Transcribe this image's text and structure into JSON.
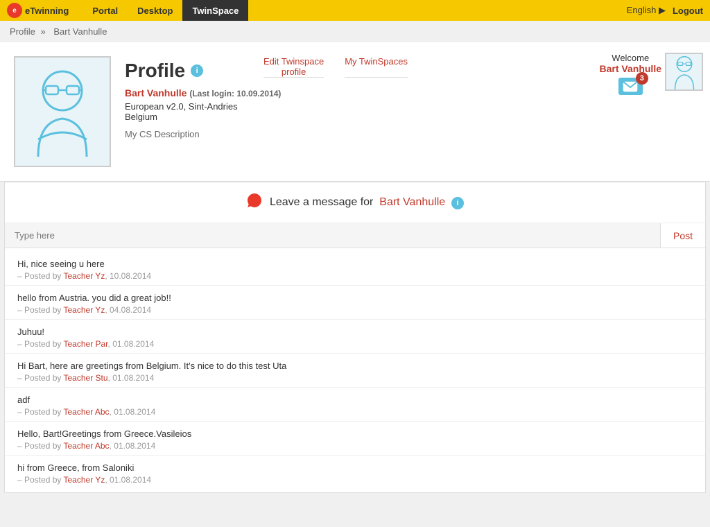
{
  "nav": {
    "logo_text": "eTwinning",
    "items": [
      "Portal",
      "Desktop",
      "TwinSpace"
    ],
    "active": "TwinSpace",
    "language": "English",
    "logout": "Logout"
  },
  "breadcrumb": {
    "profile": "Profile",
    "separator": "»",
    "current": "Bart Vanhulle"
  },
  "profile": {
    "title": "Profile",
    "info_icon": "i",
    "user_name": "Bart Vanhulle",
    "last_login_label": "(Last login: 10.09.2014)",
    "location": "European v2.0, Sint-Andries",
    "country": "Belgium",
    "description": "My CS Description",
    "edit_link_line1": "Edit Twinspace",
    "edit_link_line2": "profile",
    "my_twinspaces": "My TwinSpaces",
    "welcome_text": "Welcome",
    "welcome_name": "Bart Vanhulle",
    "mail_count": "3"
  },
  "message_section": {
    "title_prefix": "Leave a message for",
    "target_name": "Bart Vanhulle",
    "input_placeholder": "Type here",
    "post_button": "Post",
    "messages": [
      {
        "text": "Hi, nice seeing u here",
        "posted_by": "Teacher Yz",
        "date": "10.08.2014"
      },
      {
        "text": "hello from Austria. you did a great job!!",
        "posted_by": "Teacher Yz",
        "date": "04.08.2014"
      },
      {
        "text": "Juhuu!",
        "posted_by": "Teacher Par",
        "date": "01.08.2014"
      },
      {
        "text": "Hi Bart, here are greetings from Belgium. It's nice to do this test Uta",
        "posted_by": "Teacher Stu",
        "date": "01.08.2014"
      },
      {
        "text": "adf",
        "posted_by": "Teacher Abc",
        "date": "01.08.2014"
      },
      {
        "text": "Hello, Bart!Greetings from Greece.Vasileios",
        "posted_by": "Teacher Abc",
        "date": "01.08.2014"
      },
      {
        "text": "hi from Greece, from Saloniki",
        "posted_by": "Teacher Yz",
        "date": "01.08.2014"
      }
    ]
  }
}
